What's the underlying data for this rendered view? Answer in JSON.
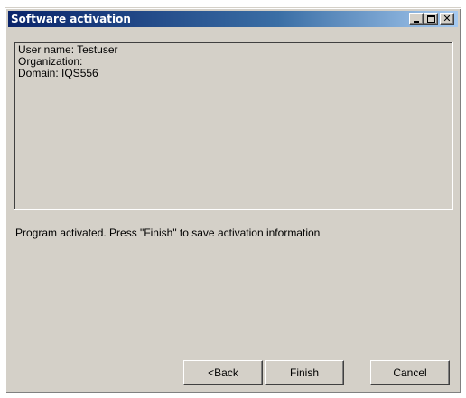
{
  "window": {
    "title": "Software activation"
  },
  "info": {
    "lines": [
      "User name: Testuser",
      "Organization:",
      "Domain: IQS556"
    ]
  },
  "status": {
    "message": "Program activated. Press \"Finish\" to save activation information"
  },
  "buttons": {
    "back": "<Back",
    "finish": "Finish",
    "cancel": "Cancel"
  },
  "colors": {
    "titlebar_start": "#0a246a",
    "titlebar_end": "#a6caf0",
    "face": "#d4d0c8"
  },
  "icons": {
    "minimize": "minimize-icon",
    "maximize": "maximize-icon",
    "close": "close-icon"
  }
}
